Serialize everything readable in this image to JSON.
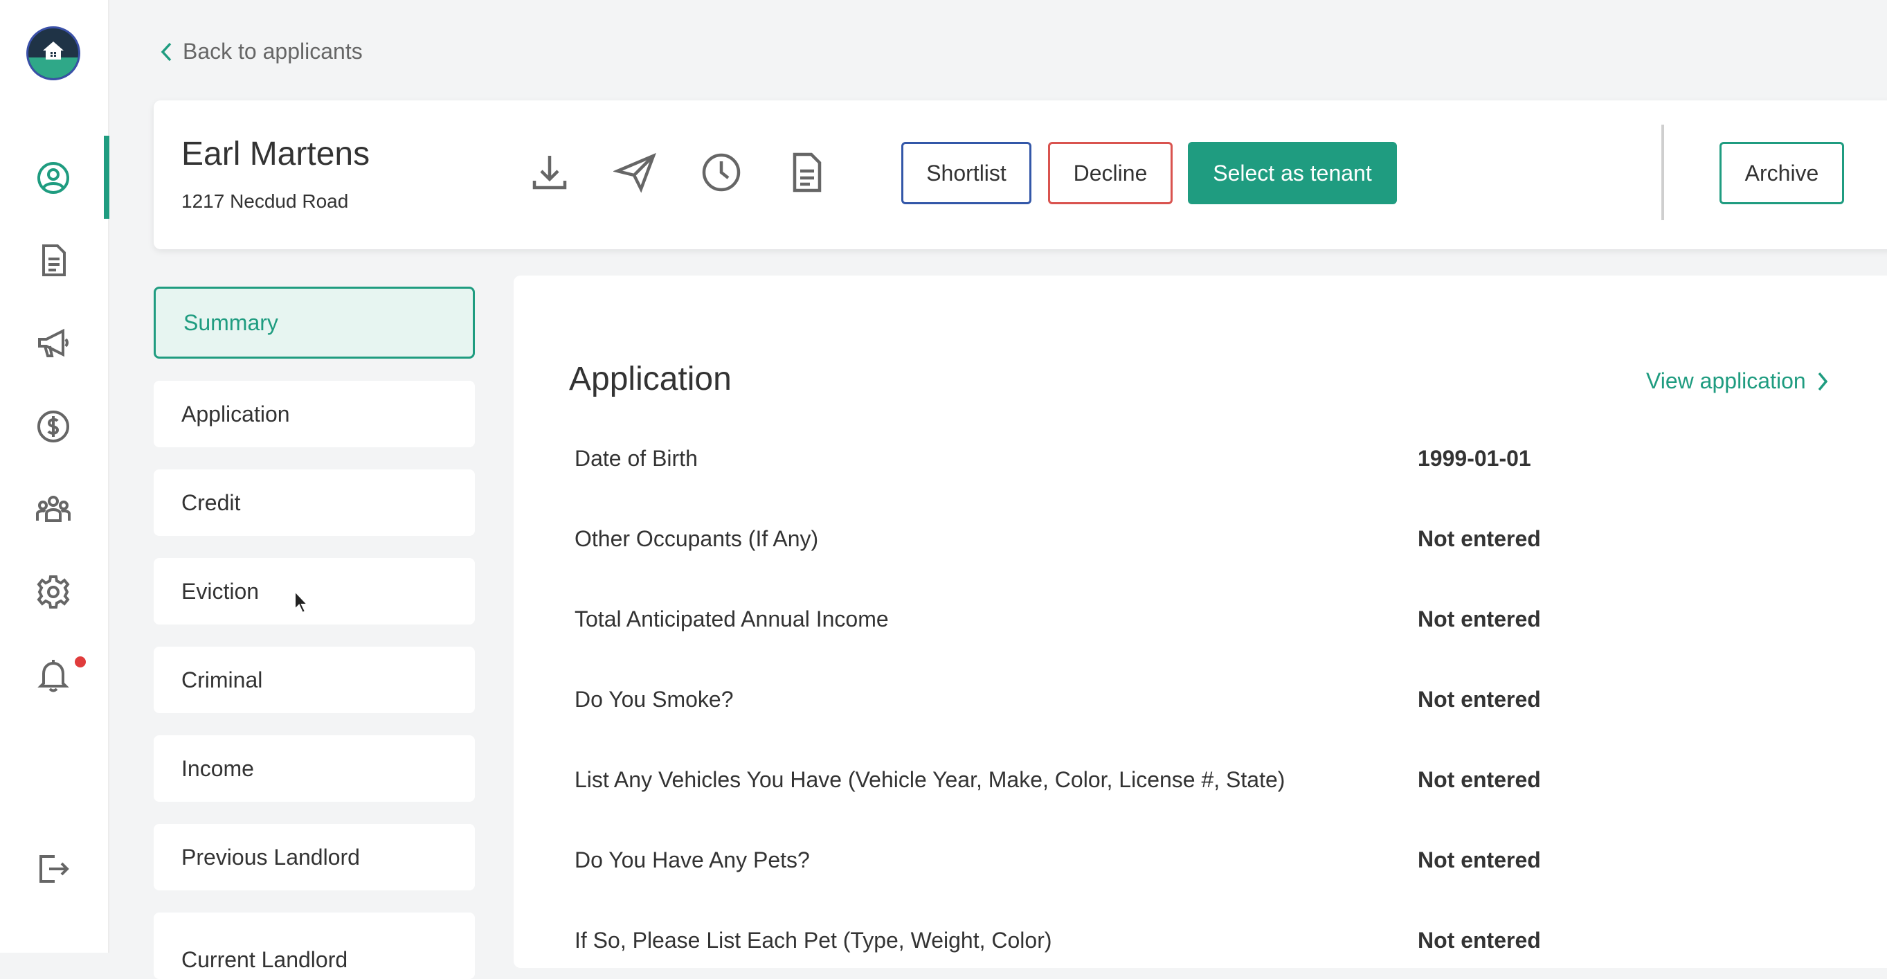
{
  "colors": {
    "accent": "#1f9c80",
    "shortlist_border": "#3357a8",
    "decline_border": "#d9534f",
    "notification": "#e03c3c"
  },
  "nav": {
    "items": [
      {
        "icon": "user-circle-icon"
      },
      {
        "icon": "document-icon"
      },
      {
        "icon": "megaphone-icon"
      },
      {
        "icon": "dollar-icon"
      },
      {
        "icon": "people-icon"
      },
      {
        "icon": "gear-icon"
      },
      {
        "icon": "bell-icon"
      },
      {
        "icon": "logout-icon"
      }
    ]
  },
  "back_link": "Back to applicants",
  "applicant": {
    "name": "Earl Martens",
    "address": "1217 Necdud Road"
  },
  "header_icons": [
    "download-icon",
    "send-icon",
    "clock-icon",
    "file-icon"
  ],
  "actions": {
    "shortlist": "Shortlist",
    "decline": "Decline",
    "select": "Select as tenant",
    "archive": "Archive"
  },
  "sidebar": {
    "items": [
      {
        "label": "Summary"
      },
      {
        "label": "Application"
      },
      {
        "label": "Credit"
      },
      {
        "label": "Eviction"
      },
      {
        "label": "Criminal"
      },
      {
        "label": "Income"
      },
      {
        "label": "Previous Landlord"
      },
      {
        "label": "Current Landlord"
      }
    ]
  },
  "application": {
    "title": "Application",
    "view_link": "View application",
    "rows": [
      {
        "label": "Date of Birth",
        "value": "1999-01-01"
      },
      {
        "label": "Other Occupants (If Any)",
        "value": "Not entered"
      },
      {
        "label": "Total Anticipated Annual Income",
        "value": "Not entered"
      },
      {
        "label": "Do You Smoke?",
        "value": "Not entered"
      },
      {
        "label": "List Any Vehicles You Have (Vehicle Year, Make, Color, License #, State)",
        "value": "Not entered"
      },
      {
        "label": "Do You Have Any Pets?",
        "value": "Not entered"
      },
      {
        "label": "If So, Please List Each Pet (Type, Weight, Color)",
        "value": "Not entered"
      }
    ]
  }
}
